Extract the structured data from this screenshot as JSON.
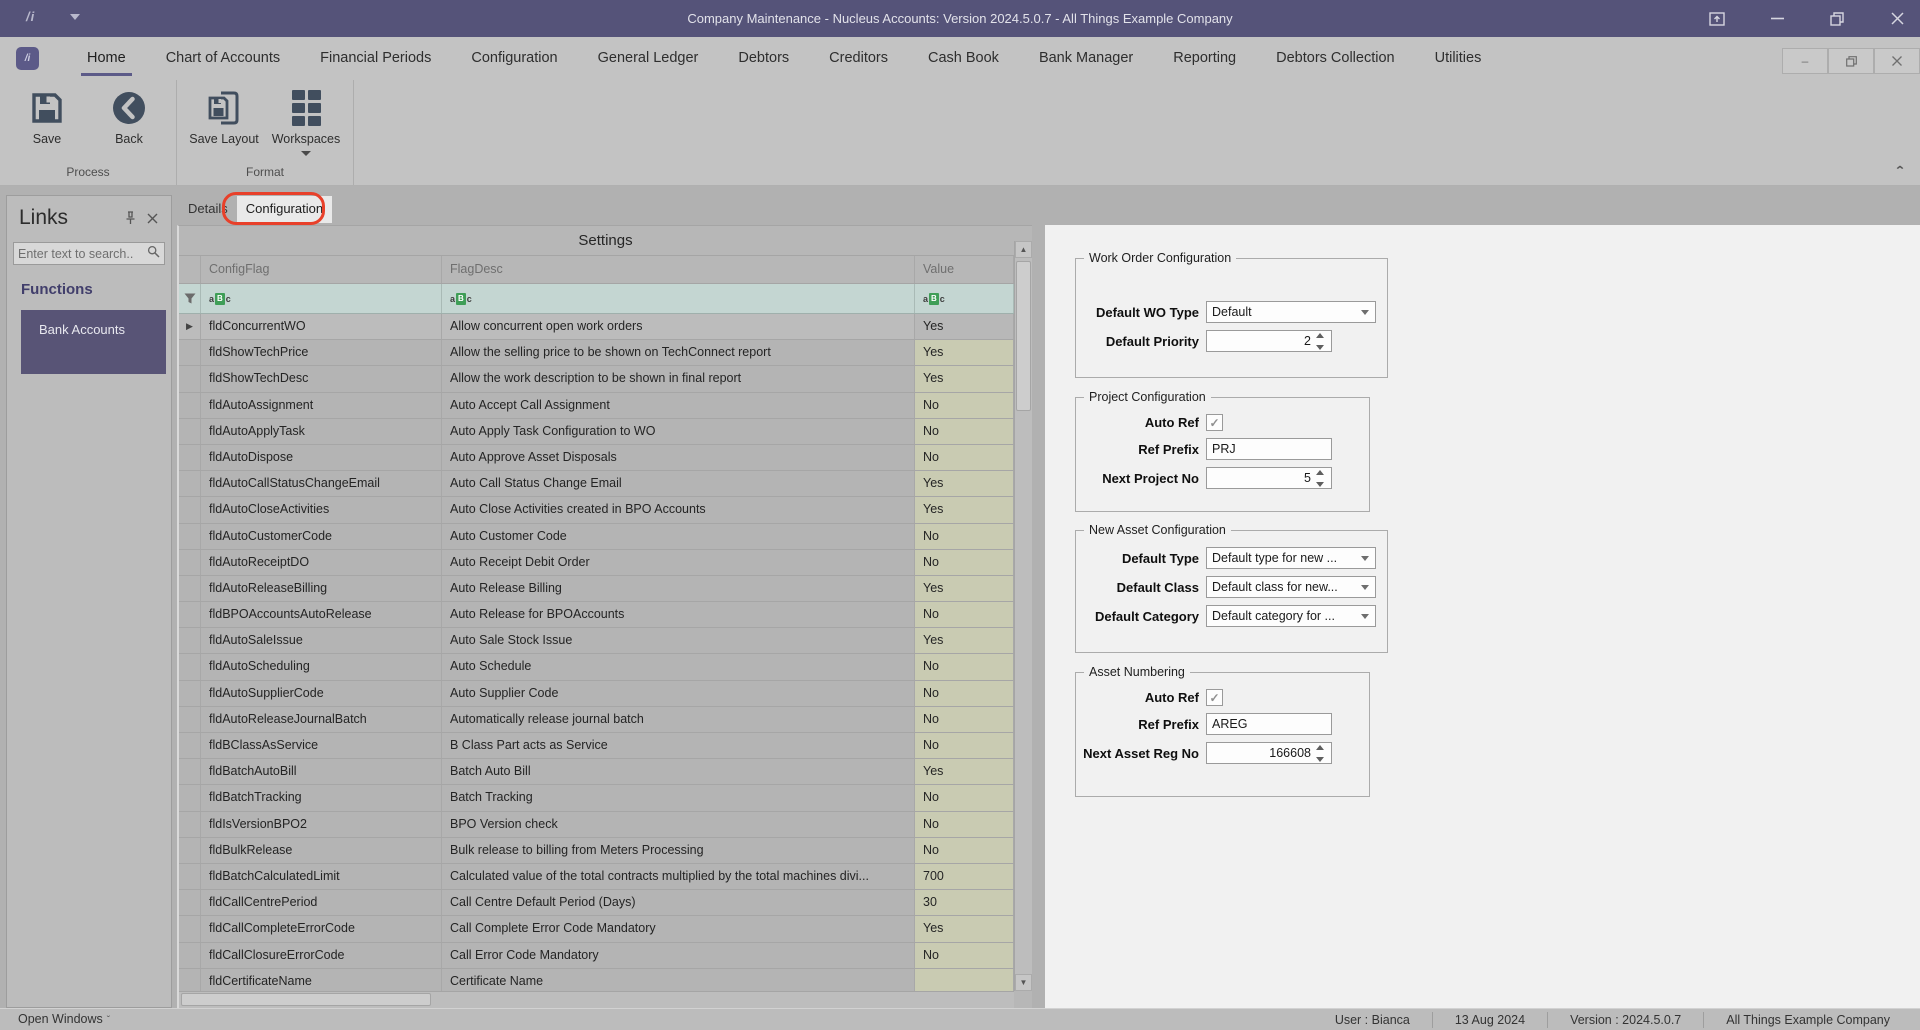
{
  "window": {
    "title": "Company Maintenance - Nucleus Accounts: Version 2024.5.0.7 - All Things Example Company",
    "logo": "/i"
  },
  "menubar": {
    "tabs": [
      "Home",
      "Chart of Accounts",
      "Financial Periods",
      "Configuration",
      "General Ledger",
      "Debtors",
      "Creditors",
      "Cash Book",
      "Bank Manager",
      "Reporting",
      "Debtors Collection",
      "Utilities"
    ],
    "active_tab": "Home"
  },
  "ribbon": {
    "groups": [
      {
        "label": "Process",
        "buttons": [
          {
            "label": "Save",
            "icon": "save-icon",
            "dropdown": false
          },
          {
            "label": "Back",
            "icon": "back-icon",
            "dropdown": false
          }
        ]
      },
      {
        "label": "Format",
        "buttons": [
          {
            "label": "Save Layout",
            "icon": "save-layout-icon",
            "dropdown": false
          },
          {
            "label": "Workspaces",
            "icon": "workspaces-icon",
            "dropdown": true
          }
        ]
      }
    ]
  },
  "links_panel": {
    "title": "Links",
    "search_placeholder": "Enter text to search..",
    "section": "Functions",
    "items": [
      "Bank Accounts"
    ]
  },
  "content": {
    "tabs": [
      "Details",
      "Configuration"
    ],
    "active_tab": "Configuration"
  },
  "grid": {
    "title": "Settings",
    "columns": [
      "ConfigFlag",
      "FlagDesc",
      "Value"
    ],
    "rows": [
      [
        "fldConcurrentWO",
        "Allow concurrent open work orders",
        "Yes"
      ],
      [
        "fldShowTechPrice",
        "Allow the selling price to be shown on TechConnect report",
        "Yes"
      ],
      [
        "fldShowTechDesc",
        "Allow the work description to be shown in final report",
        "Yes"
      ],
      [
        "fldAutoAssignment",
        "Auto Accept Call Assignment",
        "No"
      ],
      [
        "fldAutoApplyTask",
        "Auto Apply Task Configuration to WO",
        "No"
      ],
      [
        "fldAutoDispose",
        "Auto Approve Asset Disposals",
        "No"
      ],
      [
        "fldAutoCallStatusChangeEmail",
        "Auto Call Status Change Email",
        "Yes"
      ],
      [
        "fldAutoCloseActivities",
        "Auto Close Activities created in BPO Accounts",
        "Yes"
      ],
      [
        "fldAutoCustomerCode",
        "Auto Customer Code",
        "No"
      ],
      [
        "fldAutoReceiptDO",
        "Auto Receipt Debit Order",
        "No"
      ],
      [
        "fldAutoReleaseBilling",
        "Auto Release Billing",
        "Yes"
      ],
      [
        "fldBPOAccountsAutoRelease",
        "Auto Release for BPOAccounts",
        "No"
      ],
      [
        "fldAutoSaleIssue",
        "Auto Sale Stock Issue",
        "Yes"
      ],
      [
        "fldAutoScheduling",
        "Auto Schedule",
        "No"
      ],
      [
        "fldAutoSupplierCode",
        "Auto Supplier Code",
        "No"
      ],
      [
        "fldAutoReleaseJournalBatch",
        "Automatically release journal batch",
        "No"
      ],
      [
        "fldBClassAsService",
        "B Class Part acts as Service",
        "No"
      ],
      [
        "fldBatchAutoBill",
        "Batch Auto Bill",
        "Yes"
      ],
      [
        "fldBatchTracking",
        "Batch Tracking",
        "No"
      ],
      [
        "fldIsVersionBPO2",
        "BPO Version check",
        "No"
      ],
      [
        "fldBulkRelease",
        "Bulk release to billing from Meters Processing",
        "No"
      ],
      [
        "fldBatchCalculatedLimit",
        "Calculated value of the total contracts multiplied by the total machines divi...",
        "700"
      ],
      [
        "fldCallCentrePeriod",
        "Call Centre Default Period (Days)",
        "30"
      ],
      [
        "fldCallCompleteErrorCode",
        "Call Complete Error Code Mandatory",
        "Yes"
      ],
      [
        "fldCallClosureErrorCode",
        "Call Error Code Mandatory",
        "No"
      ],
      [
        "fldCertificateName",
        "Certificate Name",
        ""
      ]
    ]
  },
  "right_panel": {
    "groups": [
      {
        "title": "Work Order Configuration",
        "fields": [
          {
            "label": "Default WO Type",
            "type": "dropdown",
            "value": "Default"
          },
          {
            "label": "Default Priority",
            "type": "spin",
            "value": "2"
          }
        ]
      },
      {
        "title": "Project Configuration",
        "fields": [
          {
            "label": "Auto Ref",
            "type": "checkbox",
            "value": "checked"
          },
          {
            "label": "Ref Prefix",
            "type": "text",
            "value": "PRJ"
          },
          {
            "label": "Next Project No",
            "type": "spin",
            "value": "5"
          }
        ]
      },
      {
        "title": "New Asset Configuration",
        "fields": [
          {
            "label": "Default Type",
            "type": "dropdown",
            "value": "Default type for new ..."
          },
          {
            "label": "Default Class",
            "type": "dropdown",
            "value": "Default class for new..."
          },
          {
            "label": "Default Category",
            "type": "dropdown",
            "value": "Default category for ..."
          }
        ]
      },
      {
        "title": "Asset Numbering",
        "fields": [
          {
            "label": "Auto Ref",
            "type": "checkbox",
            "value": "checked"
          },
          {
            "label": "Ref Prefix",
            "type": "text",
            "value": "AREG"
          },
          {
            "label": "Next Asset Reg No",
            "type": "spin",
            "value": "166608"
          }
        ]
      }
    ]
  },
  "status_bar": {
    "open_windows": "Open Windows",
    "segments": [
      "User : Bianca",
      "13 Aug 2024",
      "Version : 2024.5.0.7",
      "All Things Example Company"
    ]
  }
}
